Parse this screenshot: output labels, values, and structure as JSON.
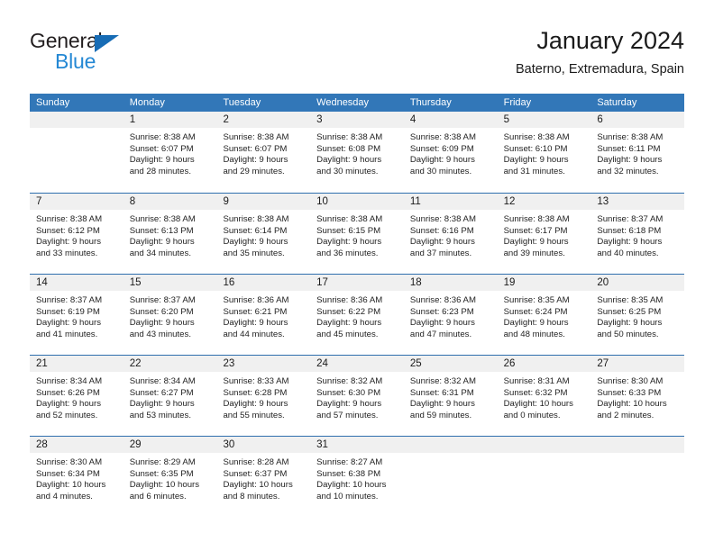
{
  "logo": {
    "word_one": "General",
    "word_two": "Blue",
    "triangle_icon": "triangle-icon",
    "accent_dark": "#231f20",
    "accent_blue": "#2488d4",
    "triangle_blue": "#176cb5"
  },
  "header": {
    "title": "January 2024",
    "subtitle": "Baterno, Extremadura, Spain"
  },
  "theme": {
    "header_blue": "#3277b8",
    "row_divider_blue": "#2f6fae",
    "day_number_band": "#f0f0f0"
  },
  "weekdays": [
    "Sunday",
    "Monday",
    "Tuesday",
    "Wednesday",
    "Thursday",
    "Friday",
    "Saturday"
  ],
  "labels": {
    "sunrise_prefix": "Sunrise:",
    "sunset_prefix": "Sunset:",
    "daylight_prefix": "Daylight:"
  },
  "weeks": [
    [
      {
        "day": "",
        "line1": "",
        "line2": "",
        "line3": "",
        "line4": ""
      },
      {
        "day": "1",
        "line1": "Sunrise: 8:38 AM",
        "line2": "Sunset: 6:07 PM",
        "line3": "Daylight: 9 hours",
        "line4": "and 28 minutes."
      },
      {
        "day": "2",
        "line1": "Sunrise: 8:38 AM",
        "line2": "Sunset: 6:07 PM",
        "line3": "Daylight: 9 hours",
        "line4": "and 29 minutes."
      },
      {
        "day": "3",
        "line1": "Sunrise: 8:38 AM",
        "line2": "Sunset: 6:08 PM",
        "line3": "Daylight: 9 hours",
        "line4": "and 30 minutes."
      },
      {
        "day": "4",
        "line1": "Sunrise: 8:38 AM",
        "line2": "Sunset: 6:09 PM",
        "line3": "Daylight: 9 hours",
        "line4": "and 30 minutes."
      },
      {
        "day": "5",
        "line1": "Sunrise: 8:38 AM",
        "line2": "Sunset: 6:10 PM",
        "line3": "Daylight: 9 hours",
        "line4": "and 31 minutes."
      },
      {
        "day": "6",
        "line1": "Sunrise: 8:38 AM",
        "line2": "Sunset: 6:11 PM",
        "line3": "Daylight: 9 hours",
        "line4": "and 32 minutes."
      }
    ],
    [
      {
        "day": "7",
        "line1": "Sunrise: 8:38 AM",
        "line2": "Sunset: 6:12 PM",
        "line3": "Daylight: 9 hours",
        "line4": "and 33 minutes."
      },
      {
        "day": "8",
        "line1": "Sunrise: 8:38 AM",
        "line2": "Sunset: 6:13 PM",
        "line3": "Daylight: 9 hours",
        "line4": "and 34 minutes."
      },
      {
        "day": "9",
        "line1": "Sunrise: 8:38 AM",
        "line2": "Sunset: 6:14 PM",
        "line3": "Daylight: 9 hours",
        "line4": "and 35 minutes."
      },
      {
        "day": "10",
        "line1": "Sunrise: 8:38 AM",
        "line2": "Sunset: 6:15 PM",
        "line3": "Daylight: 9 hours",
        "line4": "and 36 minutes."
      },
      {
        "day": "11",
        "line1": "Sunrise: 8:38 AM",
        "line2": "Sunset: 6:16 PM",
        "line3": "Daylight: 9 hours",
        "line4": "and 37 minutes."
      },
      {
        "day": "12",
        "line1": "Sunrise: 8:38 AM",
        "line2": "Sunset: 6:17 PM",
        "line3": "Daylight: 9 hours",
        "line4": "and 39 minutes."
      },
      {
        "day": "13",
        "line1": "Sunrise: 8:37 AM",
        "line2": "Sunset: 6:18 PM",
        "line3": "Daylight: 9 hours",
        "line4": "and 40 minutes."
      }
    ],
    [
      {
        "day": "14",
        "line1": "Sunrise: 8:37 AM",
        "line2": "Sunset: 6:19 PM",
        "line3": "Daylight: 9 hours",
        "line4": "and 41 minutes."
      },
      {
        "day": "15",
        "line1": "Sunrise: 8:37 AM",
        "line2": "Sunset: 6:20 PM",
        "line3": "Daylight: 9 hours",
        "line4": "and 43 minutes."
      },
      {
        "day": "16",
        "line1": "Sunrise: 8:36 AM",
        "line2": "Sunset: 6:21 PM",
        "line3": "Daylight: 9 hours",
        "line4": "and 44 minutes."
      },
      {
        "day": "17",
        "line1": "Sunrise: 8:36 AM",
        "line2": "Sunset: 6:22 PM",
        "line3": "Daylight: 9 hours",
        "line4": "and 45 minutes."
      },
      {
        "day": "18",
        "line1": "Sunrise: 8:36 AM",
        "line2": "Sunset: 6:23 PM",
        "line3": "Daylight: 9 hours",
        "line4": "and 47 minutes."
      },
      {
        "day": "19",
        "line1": "Sunrise: 8:35 AM",
        "line2": "Sunset: 6:24 PM",
        "line3": "Daylight: 9 hours",
        "line4": "and 48 minutes."
      },
      {
        "day": "20",
        "line1": "Sunrise: 8:35 AM",
        "line2": "Sunset: 6:25 PM",
        "line3": "Daylight: 9 hours",
        "line4": "and 50 minutes."
      }
    ],
    [
      {
        "day": "21",
        "line1": "Sunrise: 8:34 AM",
        "line2": "Sunset: 6:26 PM",
        "line3": "Daylight: 9 hours",
        "line4": "and 52 minutes."
      },
      {
        "day": "22",
        "line1": "Sunrise: 8:34 AM",
        "line2": "Sunset: 6:27 PM",
        "line3": "Daylight: 9 hours",
        "line4": "and 53 minutes."
      },
      {
        "day": "23",
        "line1": "Sunrise: 8:33 AM",
        "line2": "Sunset: 6:28 PM",
        "line3": "Daylight: 9 hours",
        "line4": "and 55 minutes."
      },
      {
        "day": "24",
        "line1": "Sunrise: 8:32 AM",
        "line2": "Sunset: 6:30 PM",
        "line3": "Daylight: 9 hours",
        "line4": "and 57 minutes."
      },
      {
        "day": "25",
        "line1": "Sunrise: 8:32 AM",
        "line2": "Sunset: 6:31 PM",
        "line3": "Daylight: 9 hours",
        "line4": "and 59 minutes."
      },
      {
        "day": "26",
        "line1": "Sunrise: 8:31 AM",
        "line2": "Sunset: 6:32 PM",
        "line3": "Daylight: 10 hours",
        "line4": "and 0 minutes."
      },
      {
        "day": "27",
        "line1": "Sunrise: 8:30 AM",
        "line2": "Sunset: 6:33 PM",
        "line3": "Daylight: 10 hours",
        "line4": "and 2 minutes."
      }
    ],
    [
      {
        "day": "28",
        "line1": "Sunrise: 8:30 AM",
        "line2": "Sunset: 6:34 PM",
        "line3": "Daylight: 10 hours",
        "line4": "and 4 minutes."
      },
      {
        "day": "29",
        "line1": "Sunrise: 8:29 AM",
        "line2": "Sunset: 6:35 PM",
        "line3": "Daylight: 10 hours",
        "line4": "and 6 minutes."
      },
      {
        "day": "30",
        "line1": "Sunrise: 8:28 AM",
        "line2": "Sunset: 6:37 PM",
        "line3": "Daylight: 10 hours",
        "line4": "and 8 minutes."
      },
      {
        "day": "31",
        "line1": "Sunrise: 8:27 AM",
        "line2": "Sunset: 6:38 PM",
        "line3": "Daylight: 10 hours",
        "line4": "and 10 minutes."
      },
      {
        "day": "",
        "line1": "",
        "line2": "",
        "line3": "",
        "line4": ""
      },
      {
        "day": "",
        "line1": "",
        "line2": "",
        "line3": "",
        "line4": ""
      },
      {
        "day": "",
        "line1": "",
        "line2": "",
        "line3": "",
        "line4": ""
      }
    ]
  ]
}
